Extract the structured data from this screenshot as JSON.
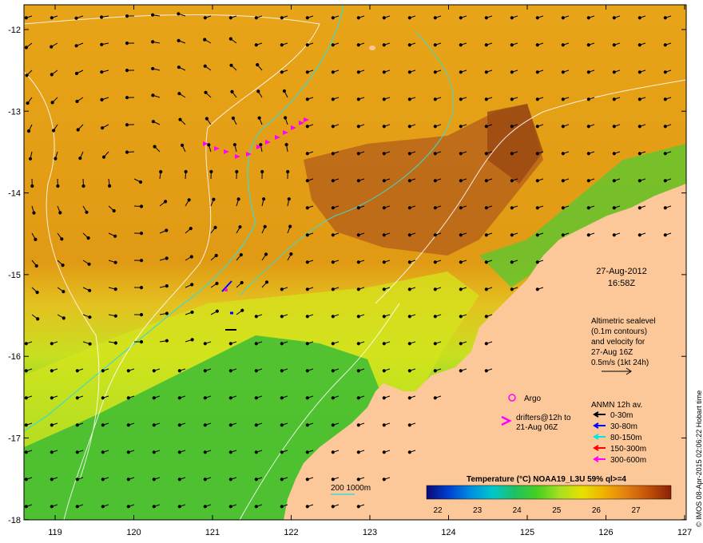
{
  "map": {
    "date": "27-Aug-2012",
    "time": "16:58Z",
    "credit": "© IMOS 08-Apr-2015 02:06:22 Hobart time",
    "x_ticks": [
      "119",
      "120",
      "121",
      "122",
      "123",
      "124",
      "125",
      "126",
      "127"
    ],
    "y_ticks": [
      "-12",
      "-13",
      "-14",
      "-15",
      "-16",
      "-17",
      "-18"
    ],
    "altimetry": {
      "lines": [
        "Altimetric sealevel",
        "(0.1m contours)",
        "and velocity for",
        "27-Aug 16Z",
        "0.5m/s (1kt 24h)"
      ]
    },
    "argo_label": "Argo",
    "drifters_lines": [
      "drifters@12h to",
      "21-Aug 06Z"
    ],
    "anmn": {
      "title": "ANMN 12h av.",
      "items": [
        {
          "label": "0-30m",
          "color": "#000000"
        },
        {
          "label": "30-80m",
          "color": "#0000ff"
        },
        {
          "label": "80-150m",
          "color": "#00e5e5"
        },
        {
          "label": "150-300m",
          "color": "#ff0000"
        },
        {
          "label": "300-600m",
          "color": "#ff00ff"
        }
      ]
    },
    "isobath_label": "200  1000m",
    "colorbar": {
      "title": "Temperature (°C) NOAA19_L3U 59% ql>=4",
      "ticks": [
        "22",
        "23",
        "24",
        "25",
        "26",
        "27"
      ],
      "colors": [
        "#0a0a7a",
        "#0040d0",
        "#0090e0",
        "#00c8c8",
        "#20c060",
        "#48d020",
        "#a8e020",
        "#e8e000",
        "#f0b000",
        "#e08010",
        "#c05008",
        "#8a2008"
      ]
    },
    "colors": {
      "land": "#fcc89a",
      "sst_warm": "#e69a10",
      "sst_hot": "#b85a10",
      "sst_cool": "#d8e820",
      "sst_cold": "#40c030",
      "isobath": "#3fd9cc",
      "drifter": "#ff00ff"
    }
  }
}
